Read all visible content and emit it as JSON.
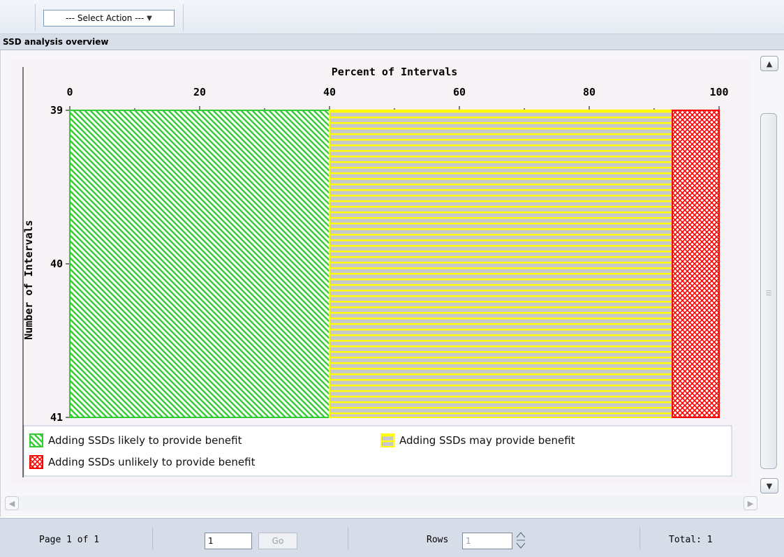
{
  "toolbar": {
    "select_action_label": "--- Select Action ---"
  },
  "section": {
    "title": "SSD analysis overview"
  },
  "chart_data": {
    "type": "bar",
    "orientation": "horizontal",
    "stacked": true,
    "x_label": "Percent of Intervals",
    "y_label": "Number of Intervals",
    "x_ticks": [
      "0",
      "20",
      "40",
      "60",
      "80",
      "100"
    ],
    "y_ticks": [
      "39",
      "40",
      "41"
    ],
    "xlim": [
      0,
      100
    ],
    "series": [
      {
        "name": "Adding SSDs likely to provide benefit",
        "value": 40,
        "color": "#33cc33",
        "pattern": "diagonal"
      },
      {
        "name": "Adding SSDs may provide benefit",
        "value": 52.8,
        "color": "#ffff00",
        "pattern": "horizontal"
      },
      {
        "name": "Adding SSDs unlikely to provide benefit",
        "value": 7.2,
        "color": "#ff0000",
        "pattern": "crosshatch"
      }
    ],
    "legend_position": "bottom"
  },
  "pagination": {
    "page_info": "Page 1 of 1",
    "page_input_value": "1",
    "go_label": "Go",
    "rows_label": "Rows",
    "rows_input_value": "1",
    "total_info": "Total: 1"
  }
}
